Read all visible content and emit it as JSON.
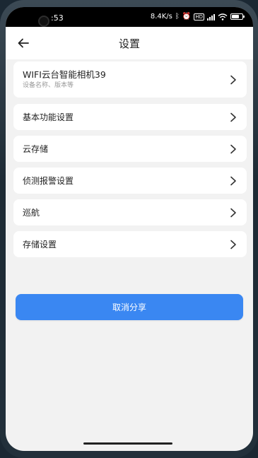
{
  "status_bar": {
    "time": ":53",
    "speed": "8.4K/s",
    "hd": "HD"
  },
  "header": {
    "title": "设置",
    "back_icon": "arrow-left-icon"
  },
  "device": {
    "name": "WIFI云台智能相机39",
    "subtitle": "设备名称、版本等"
  },
  "menu": {
    "items": [
      {
        "label": "基本功能设置"
      },
      {
        "label": "云存储"
      },
      {
        "label": "侦测报警设置"
      },
      {
        "label": "巡航"
      },
      {
        "label": "存储设置"
      }
    ]
  },
  "actions": {
    "cancel_share": "取消分享"
  },
  "colors": {
    "primary_button": "#3a87f2",
    "page_background": "#f2f2f2",
    "card_background": "#ffffff"
  }
}
